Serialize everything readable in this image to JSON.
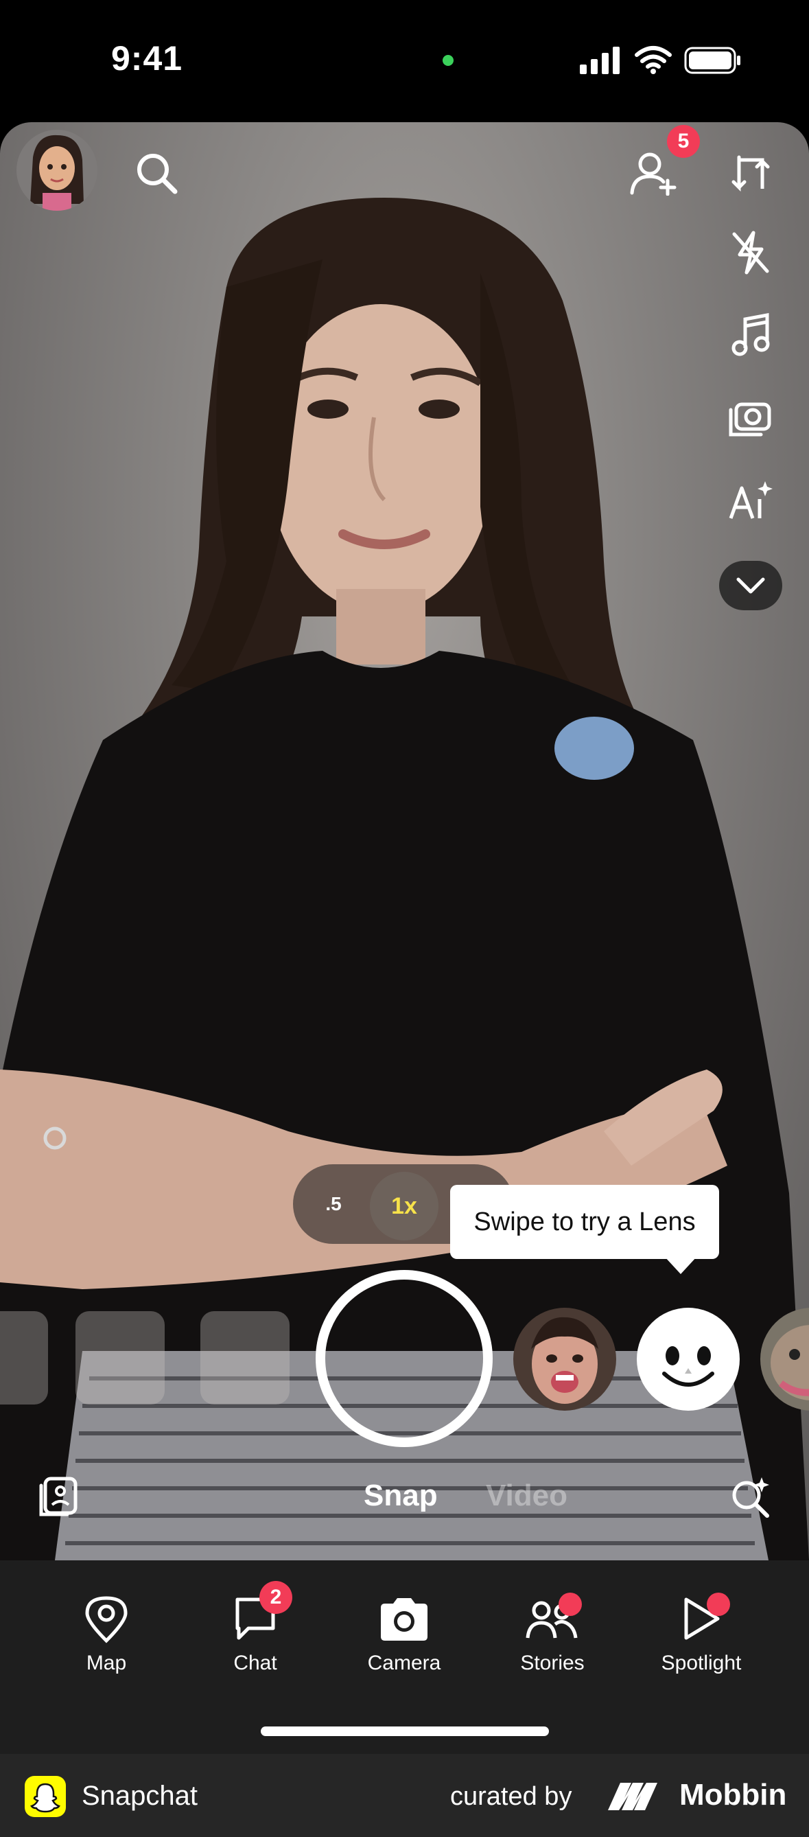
{
  "status_bar": {
    "time": "9:41"
  },
  "camera": {
    "top_controls": {
      "friend_requests_badge": "5",
      "side_tools": [
        "flip-camera-icon",
        "flash-off-icon",
        "music-icon",
        "camera-timer-icon",
        "ai-icon",
        "chevron-down-icon"
      ]
    },
    "zoom": {
      "half": ".5",
      "one": "1x",
      "selected": "1x"
    },
    "tooltip": "Swipe to try a Lens",
    "modes": {
      "snap": "Snap",
      "video": "Video",
      "active": "Snap"
    }
  },
  "nav": {
    "items": [
      {
        "label": "Map",
        "icon": "map-pin-icon"
      },
      {
        "label": "Chat",
        "icon": "chat-icon",
        "badge": "2"
      },
      {
        "label": "Camera",
        "icon": "camera-icon"
      },
      {
        "label": "Stories",
        "icon": "stories-icon"
      },
      {
        "label": "Spotlight",
        "icon": "spotlight-icon"
      }
    ]
  },
  "footer": {
    "app_name": "Snapchat",
    "curated_by": "curated by",
    "brand": "Mobbin"
  },
  "colors": {
    "accent_red": "#f23c57",
    "zoom_yellow": "#f7e24a",
    "nav_bg": "#1e1e1e",
    "footer_bg": "#262626"
  }
}
